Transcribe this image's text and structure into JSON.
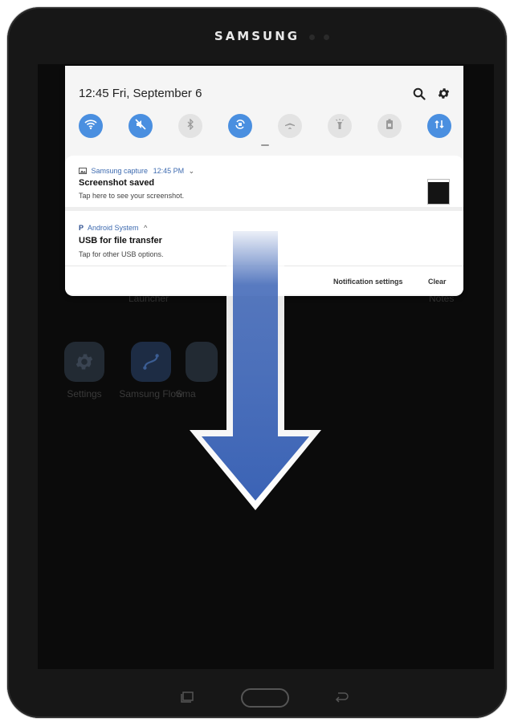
{
  "device": {
    "brand": "SAMSUNG"
  },
  "home": {
    "apps": [
      {
        "label": "Settings",
        "icon": "gear-icon"
      },
      {
        "label": "Samsung Flow",
        "icon": "flow-icon"
      },
      {
        "label": "Sma",
        "icon": "app-icon"
      }
    ],
    "dock_labels": {
      "launcher": "Launcher",
      "notes": "Notes"
    }
  },
  "quick_panel": {
    "time": "12:45",
    "date": "Fri, September 6",
    "toggles": [
      {
        "name": "wifi",
        "icon": "wifi-icon",
        "state": "on"
      },
      {
        "name": "sound",
        "icon": "mute-icon",
        "state": "on"
      },
      {
        "name": "bluetooth",
        "icon": "bluetooth-icon",
        "state": "off"
      },
      {
        "name": "auto-rotate",
        "icon": "rotate-icon",
        "state": "on"
      },
      {
        "name": "airplane",
        "icon": "airplane-icon",
        "state": "off"
      },
      {
        "name": "flashlight",
        "icon": "flashlight-icon",
        "state": "off"
      },
      {
        "name": "power-saving",
        "icon": "battery-icon",
        "state": "off"
      },
      {
        "name": "mobile-data",
        "icon": "data-arrows-icon",
        "state": "on"
      }
    ]
  },
  "notifications": [
    {
      "app": "Samsung capture",
      "time": "12:45 PM",
      "title": "Screenshot saved",
      "text": "Tap here to see your screenshot."
    },
    {
      "app": "Android System",
      "title": "USB for file transfer",
      "text": "Tap for other USB options."
    }
  ],
  "actions": {
    "settings": "Notification settings",
    "clear": "Clear"
  },
  "colors": {
    "accent": "#4a8fe0",
    "arrow": "#3b63b5"
  }
}
